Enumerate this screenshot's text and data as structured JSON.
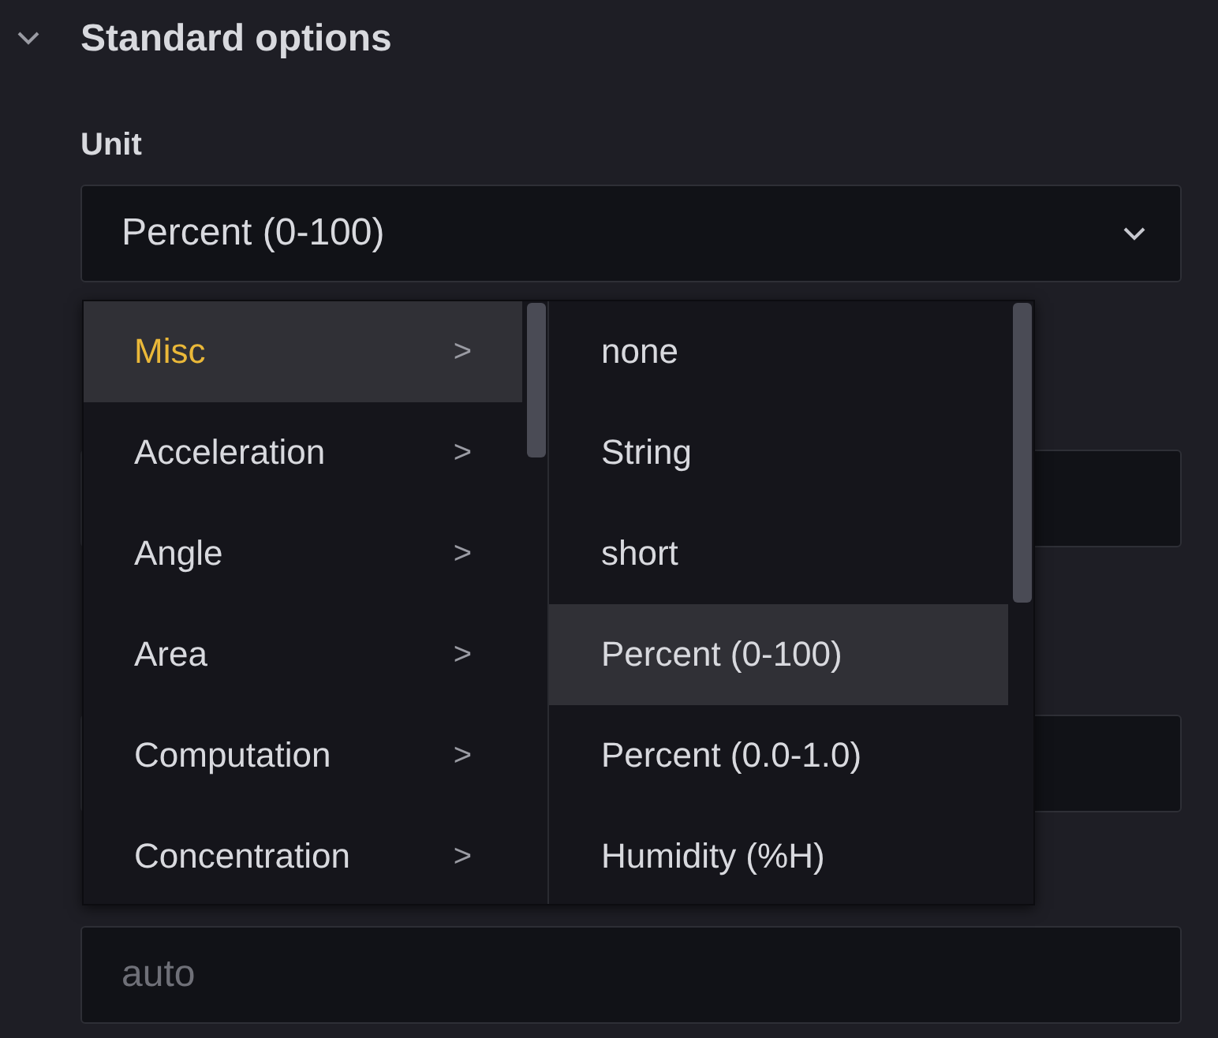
{
  "section": {
    "title": "Standard options",
    "expanded": true
  },
  "unit": {
    "label": "Unit",
    "value": "Percent (0-100)"
  },
  "menu": {
    "categories": [
      {
        "label": "Misc",
        "arrow": ">",
        "selected": true
      },
      {
        "label": "Acceleration",
        "arrow": ">",
        "selected": false
      },
      {
        "label": "Angle",
        "arrow": ">",
        "selected": false
      },
      {
        "label": "Area",
        "arrow": ">",
        "selected": false
      },
      {
        "label": "Computation",
        "arrow": ">",
        "selected": false
      },
      {
        "label": "Concentration",
        "arrow": ">",
        "selected": false
      }
    ],
    "options": [
      {
        "label": "none",
        "selected": false
      },
      {
        "label": "String",
        "selected": false
      },
      {
        "label": "short",
        "selected": false
      },
      {
        "label": "Percent (0-100)",
        "selected": true
      },
      {
        "label": "Percent (0.0-1.0)",
        "selected": false
      },
      {
        "label": "Humidity (%H)",
        "selected": false
      }
    ]
  },
  "decimals_field": {
    "placeholder": "auto"
  }
}
